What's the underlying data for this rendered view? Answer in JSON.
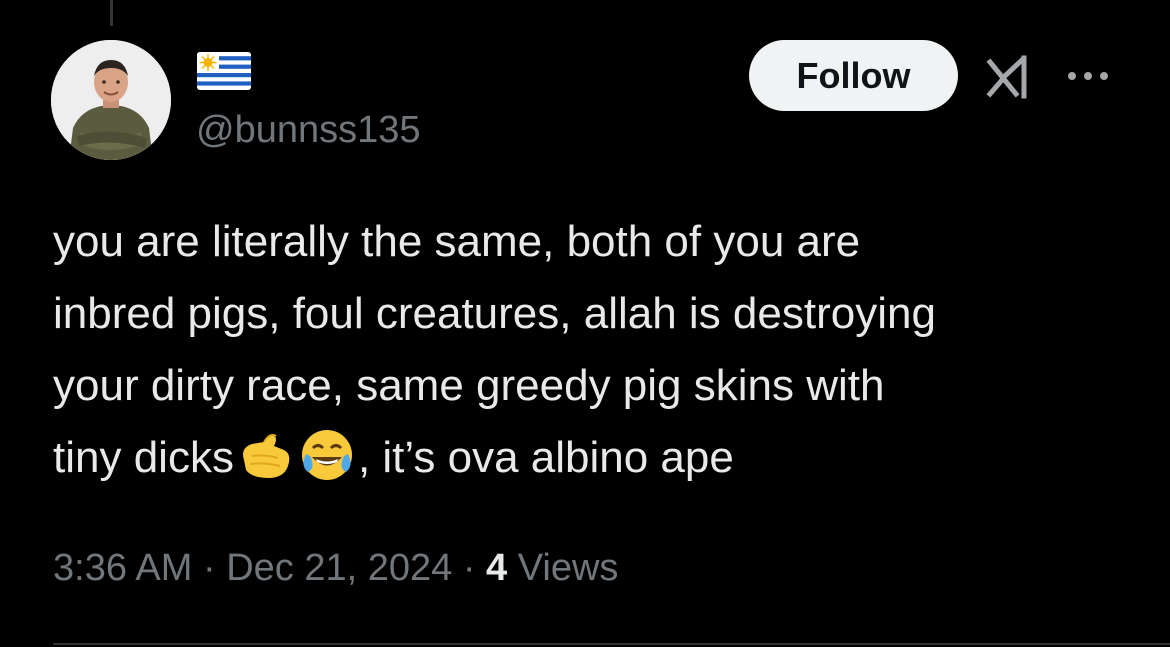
{
  "user": {
    "handle": "@bunnss135",
    "flag_icon": "uruguay-flag-icon",
    "avatar_icon": "profile-photo"
  },
  "actions": {
    "follow_label": "Follow",
    "grok_icon": "grok-icon",
    "more_icon": "more-options-icon"
  },
  "tweet": {
    "line1": "you are literally the same, both of you are",
    "line2": "inbred pigs, foul creatures, allah is destroying",
    "line3": "your dirty race, same greedy pig skins with",
    "line4_start": "tiny dicks",
    "line4_end": ", it’s ova albino ape",
    "emoji1": "pinching-hand-emoji",
    "emoji2": "tears-of-joy-emoji"
  },
  "meta": {
    "time": "3:36 AM",
    "sep1": " · ",
    "date": "Dec 21, 2024",
    "sep2": " · ",
    "views_count": "4",
    "views_label": " Views"
  },
  "colors": {
    "background": "#000000",
    "text": "#e7e9ea",
    "secondary": "#71767b",
    "follow_bg": "#eff3f4"
  }
}
